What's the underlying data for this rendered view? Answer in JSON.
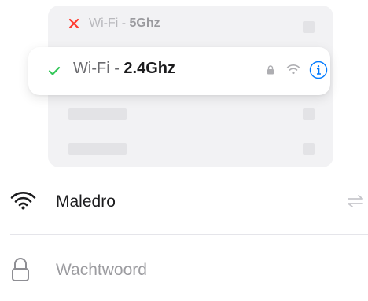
{
  "networks": {
    "unavailable": {
      "prefix": "Wi-Fi - ",
      "band": "5Ghz",
      "status_icon": "close-icon"
    },
    "selected": {
      "prefix": "Wi-Fi - ",
      "band": "2.4Ghz",
      "status_icon": "checkmark-icon"
    }
  },
  "network_field": {
    "name": "Maledro",
    "icon": "wifi-icon",
    "action_icon": "swap-icon"
  },
  "password_field": {
    "placeholder": "Wachtwoord",
    "value": "",
    "icon": "lock-icon"
  },
  "colors": {
    "error": "#ff3b30",
    "success": "#34c759",
    "accent": "#007aff",
    "muted": "#b8b8bc"
  }
}
